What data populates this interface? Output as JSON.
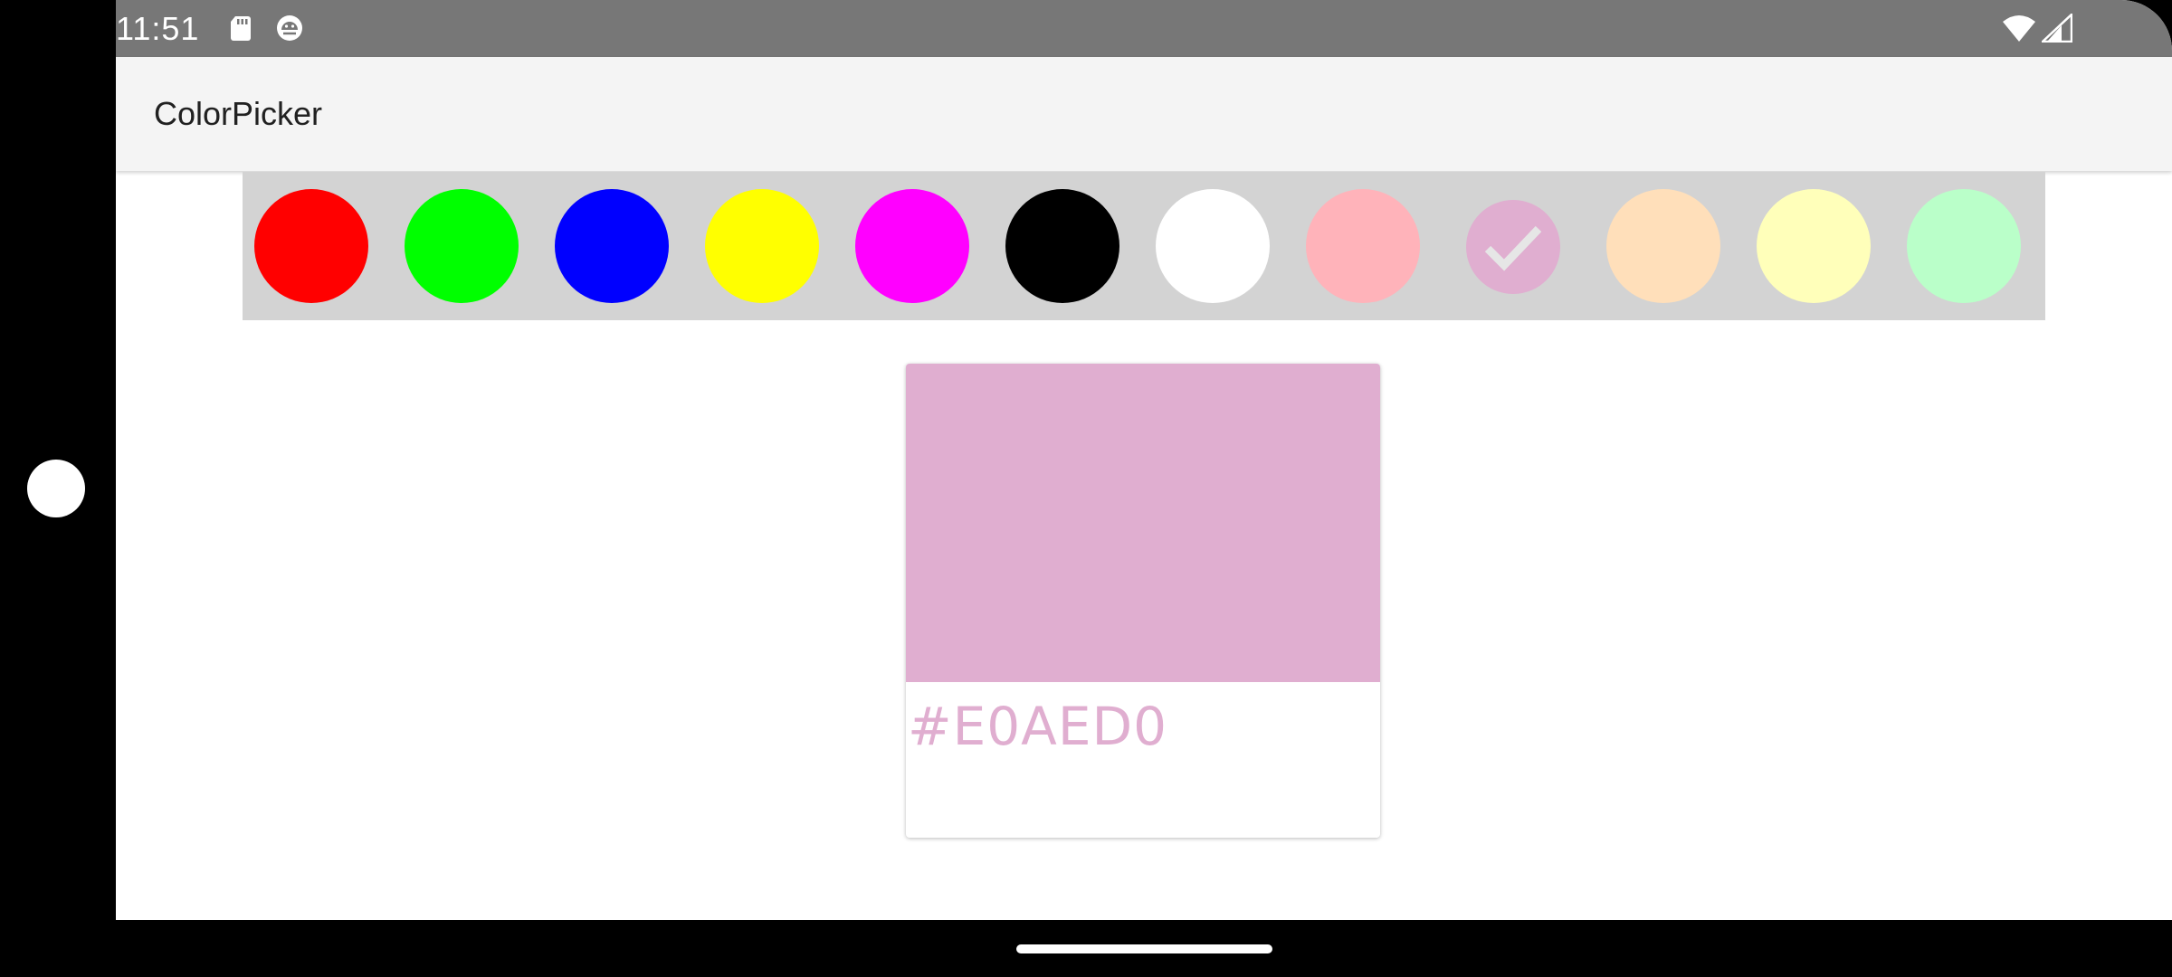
{
  "status_bar": {
    "time": "11:51",
    "left_icons": [
      "sd-card-icon",
      "android-debug-icon"
    ],
    "right_icons": [
      "wifi-icon",
      "cellular-signal-icon"
    ]
  },
  "app_bar": {
    "title": "ColorPicker"
  },
  "palette": {
    "swatches": [
      {
        "name": "red",
        "color": "#FF0000",
        "selected": false
      },
      {
        "name": "green",
        "color": "#00FF00",
        "selected": false
      },
      {
        "name": "blue",
        "color": "#0000FF",
        "selected": false
      },
      {
        "name": "yellow",
        "color": "#FFFF00",
        "selected": false
      },
      {
        "name": "magenta",
        "color": "#FF00FF",
        "selected": false
      },
      {
        "name": "black",
        "color": "#000000",
        "selected": false
      },
      {
        "name": "white",
        "color": "#FFFFFF",
        "selected": false
      },
      {
        "name": "light-pink",
        "color": "#FFB3BA",
        "selected": false
      },
      {
        "name": "light-purple",
        "color": "#E0AED0",
        "selected": true
      },
      {
        "name": "light-orange",
        "color": "#FFDFBA",
        "selected": false
      },
      {
        "name": "light-yellow",
        "color": "#FFFFBA",
        "selected": false
      },
      {
        "name": "light-green",
        "color": "#BAFFC9",
        "selected": false
      }
    ]
  },
  "preview_card": {
    "hex": "#E0AED0",
    "color": "#E0AED0"
  },
  "colors": {
    "status_bar": "#777777",
    "app_bar": "#F4F4F4",
    "palette_background": "#D3D3D3",
    "check_mark": "#E6E6E6"
  }
}
